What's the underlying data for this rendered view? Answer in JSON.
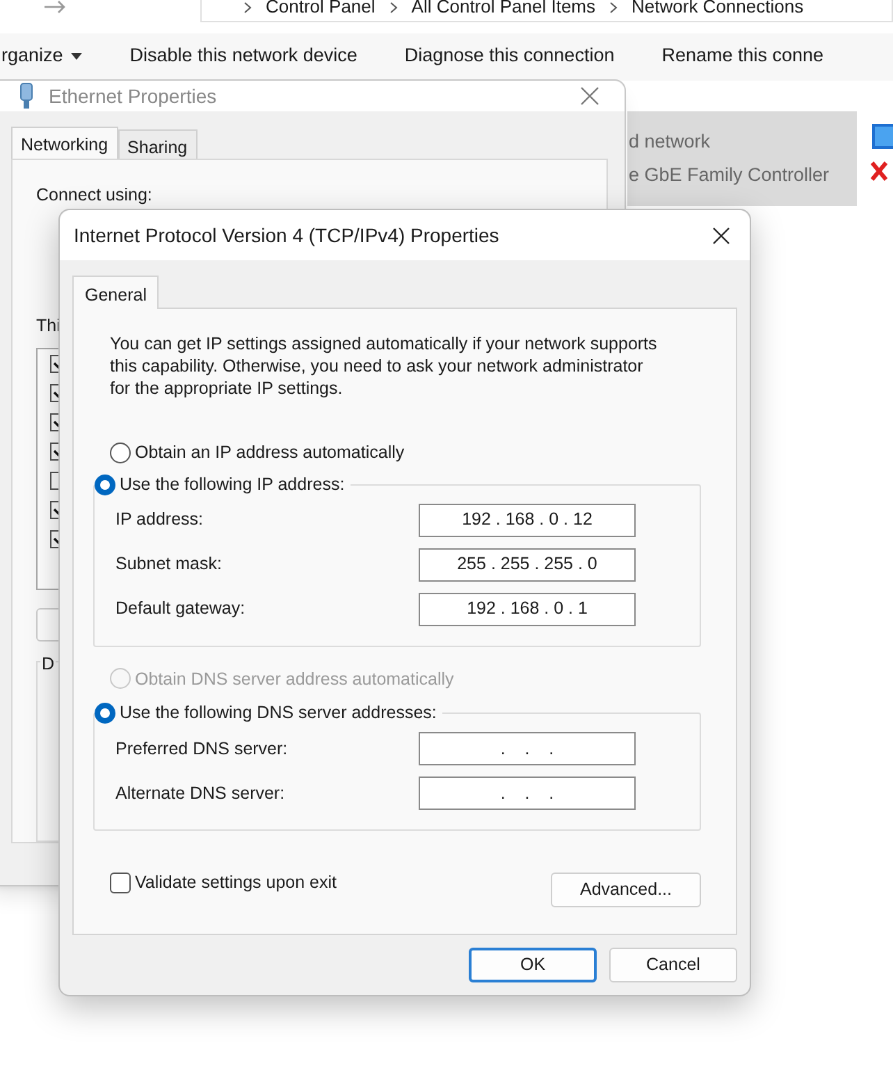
{
  "explorer": {
    "breadcrumbs": [
      "Control Panel",
      "All Control Panel Items",
      "Network Connections"
    ],
    "toolbar": [
      {
        "label": "rganize",
        "dropdown": true
      },
      {
        "label": "Disable this network device",
        "dropdown": false
      },
      {
        "label": "Diagnose this connection",
        "dropdown": false
      },
      {
        "label": "Rename this conne",
        "dropdown": false
      }
    ],
    "adapter": {
      "lines": [
        "d network",
        "e GbE Family Controller"
      ]
    }
  },
  "ethernet_window": {
    "title": "Ethernet Properties",
    "tabs": [
      {
        "label": "Networking",
        "selected": true
      },
      {
        "label": "Sharing",
        "selected": false
      }
    ],
    "connect_label": "Connect using:",
    "list_label": "Thi",
    "items": [
      {
        "checked": true
      },
      {
        "checked": true
      },
      {
        "checked": true
      },
      {
        "checked": true
      },
      {
        "checked": false
      },
      {
        "checked": true
      },
      {
        "checked": true
      }
    ],
    "group_label": "D"
  },
  "ipv4_dialog": {
    "title": "Internet Protocol Version 4 (TCP/IPv4) Properties",
    "tabs": [
      {
        "label": "General",
        "selected": true
      }
    ],
    "description": "You can get IP settings assigned automatically if your network supports this capability. Otherwise, you need to ask your network administrator for the appropriate IP settings.",
    "ip_options": [
      {
        "label": "Obtain an IP address automatically",
        "selected": false,
        "disabled": false
      },
      {
        "label": "Use the following IP address:",
        "selected": true,
        "disabled": false
      }
    ],
    "ip_fields": [
      {
        "label": "IP address:",
        "value": "192 . 168 . 0 . 12"
      },
      {
        "label": "Subnet mask:",
        "value": "255 . 255 . 255 . 0"
      },
      {
        "label": "Default gateway:",
        "value": "192 . 168 . 0 . 1"
      }
    ],
    "dns_options": [
      {
        "label": "Obtain DNS server address automatically",
        "selected": false,
        "disabled": true
      },
      {
        "label": "Use the following DNS server addresses:",
        "selected": true,
        "disabled": false
      }
    ],
    "dns_fields": [
      {
        "label": "Preferred DNS server:",
        "value": ".    .    ."
      },
      {
        "label": "Alternate DNS server:",
        "value": ".    .    ."
      }
    ],
    "validate": {
      "label": "Validate settings upon exit",
      "checked": false
    },
    "buttons": [
      {
        "label": "Advanced...",
        "default": false
      },
      {
        "label": "OK",
        "default": true
      },
      {
        "label": "Cancel",
        "default": false
      }
    ]
  }
}
